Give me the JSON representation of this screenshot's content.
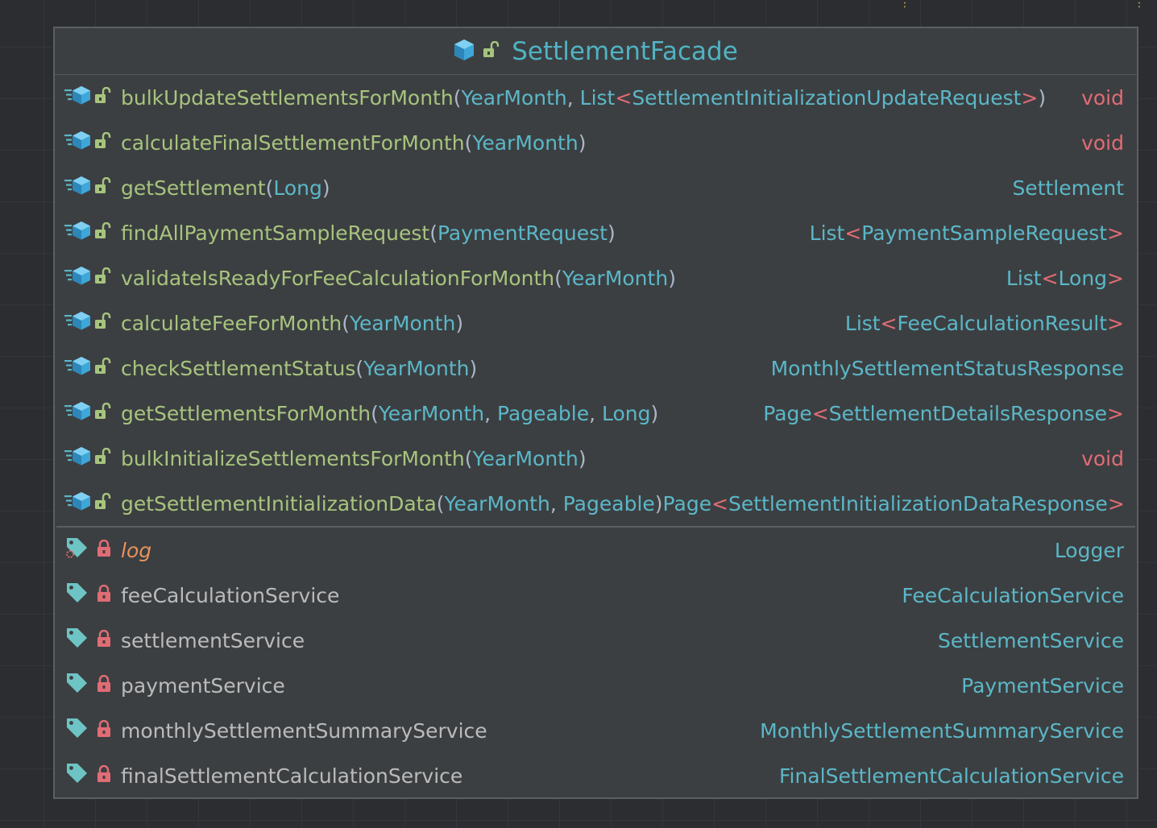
{
  "class": {
    "name": "SettlementFacade",
    "icon": "class-interface-icon",
    "visibility_icon": "public-lock-open-icon"
  },
  "methods": [
    {
      "name": "bulkUpdateSettlementsForMonth",
      "open": "(",
      "params": [
        {
          "t": "type",
          "v": "YearMonth"
        },
        {
          "t": "punc",
          "v": ", "
        },
        {
          "t": "type",
          "v": "List"
        },
        {
          "t": "angle",
          "v": "<"
        },
        {
          "t": "type",
          "v": "SettlementInitializationUpdateRequest"
        },
        {
          "t": "angle",
          "v": ">"
        }
      ],
      "close": ")",
      "return": [
        {
          "t": "void",
          "v": "void"
        }
      ]
    },
    {
      "name": "calculateFinalSettlementForMonth",
      "open": "(",
      "params": [
        {
          "t": "type",
          "v": "YearMonth"
        }
      ],
      "close": ")",
      "return": [
        {
          "t": "void",
          "v": "void"
        }
      ]
    },
    {
      "name": "getSettlement",
      "open": "(",
      "params": [
        {
          "t": "type",
          "v": "Long"
        }
      ],
      "close": ")",
      "return": [
        {
          "t": "type",
          "v": "Settlement"
        }
      ]
    },
    {
      "name": "findAllPaymentSampleRequest",
      "open": "(",
      "params": [
        {
          "t": "type",
          "v": "PaymentRequest"
        }
      ],
      "close": ")",
      "return": [
        {
          "t": "type",
          "v": "List"
        },
        {
          "t": "angle",
          "v": "<"
        },
        {
          "t": "type",
          "v": "PaymentSampleRequest"
        },
        {
          "t": "angle",
          "v": ">"
        }
      ]
    },
    {
      "name": "validateIsReadyForFeeCalculationForMonth",
      "open": "(",
      "params": [
        {
          "t": "type",
          "v": "YearMonth"
        }
      ],
      "close": ")",
      "return": [
        {
          "t": "type",
          "v": "List"
        },
        {
          "t": "angle",
          "v": "<"
        },
        {
          "t": "type",
          "v": "Long"
        },
        {
          "t": "angle",
          "v": ">"
        }
      ]
    },
    {
      "name": "calculateFeeForMonth",
      "open": "(",
      "params": [
        {
          "t": "type",
          "v": "YearMonth"
        }
      ],
      "close": ")",
      "return": [
        {
          "t": "type",
          "v": "List"
        },
        {
          "t": "angle",
          "v": "<"
        },
        {
          "t": "type",
          "v": "FeeCalculationResult"
        },
        {
          "t": "angle",
          "v": ">"
        }
      ]
    },
    {
      "name": "checkSettlementStatus",
      "open": "(",
      "params": [
        {
          "t": "type",
          "v": "YearMonth"
        }
      ],
      "close": ")",
      "return": [
        {
          "t": "type",
          "v": "MonthlySettlementStatusResponse"
        }
      ]
    },
    {
      "name": "getSettlementsForMonth",
      "open": "(",
      "params": [
        {
          "t": "type",
          "v": "YearMonth"
        },
        {
          "t": "punc",
          "v": ", "
        },
        {
          "t": "type",
          "v": "Pageable"
        },
        {
          "t": "punc",
          "v": ", "
        },
        {
          "t": "type",
          "v": "Long"
        }
      ],
      "close": ")",
      "return": [
        {
          "t": "type",
          "v": "Page"
        },
        {
          "t": "angle",
          "v": "<"
        },
        {
          "t": "type",
          "v": "SettlementDetailsResponse"
        },
        {
          "t": "angle",
          "v": ">"
        }
      ]
    },
    {
      "name": "bulkInitializeSettlementsForMonth",
      "open": "(",
      "params": [
        {
          "t": "type",
          "v": "YearMonth"
        }
      ],
      "close": ")",
      "return": [
        {
          "t": "void",
          "v": "void"
        }
      ]
    },
    {
      "name": "getSettlementInitializationData",
      "open": "(",
      "params": [
        {
          "t": "type",
          "v": "YearMonth"
        },
        {
          "t": "punc",
          "v": ", "
        },
        {
          "t": "type",
          "v": "Pageable"
        }
      ],
      "close": ")",
      "return": [
        {
          "t": "type",
          "v": "Page"
        },
        {
          "t": "angle",
          "v": "<"
        },
        {
          "t": "type",
          "v": "SettlementInitializationDataResponse"
        },
        {
          "t": "angle",
          "v": ">"
        }
      ]
    }
  ],
  "fields": [
    {
      "name": "log",
      "type": "Logger",
      "static": true
    },
    {
      "name": "feeCalculationService",
      "type": "FeeCalculationService",
      "static": false
    },
    {
      "name": "settlementService",
      "type": "SettlementService",
      "static": false
    },
    {
      "name": "paymentService",
      "type": "PaymentService",
      "static": false
    },
    {
      "name": "monthlySettlementSummaryService",
      "type": "MonthlySettlementSummaryService",
      "static": false
    },
    {
      "name": "finalSettlementCalculationService",
      "type": "FinalSettlementCalculationService",
      "static": false
    }
  ],
  "colors": {
    "method_name": "#a7c47e",
    "type": "#5bb7c8",
    "keyword_void": "#e06c75",
    "field_name": "#bbbbbb",
    "static_field": "#e6925a",
    "background": "#2b2d30",
    "panel": "#3c3f41"
  }
}
